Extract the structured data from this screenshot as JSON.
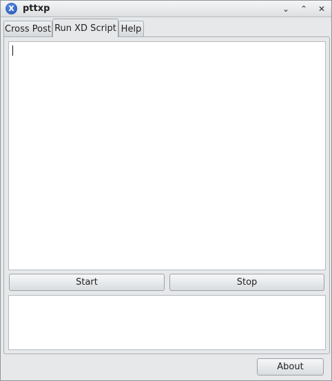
{
  "window": {
    "title": "pttxp",
    "app_icon_glyph": "X",
    "controls": {
      "minimize": "⌄",
      "maximize": "⌃",
      "close": "✕"
    }
  },
  "tabs": [
    {
      "label": "Cross Post",
      "active": false
    },
    {
      "label": "Run XD Script",
      "active": true
    },
    {
      "label": "Help",
      "active": false
    }
  ],
  "script_panel": {
    "editor_text": "",
    "start_label": "Start",
    "stop_label": "Stop",
    "output_text": ""
  },
  "footer": {
    "about_label": "About"
  }
}
